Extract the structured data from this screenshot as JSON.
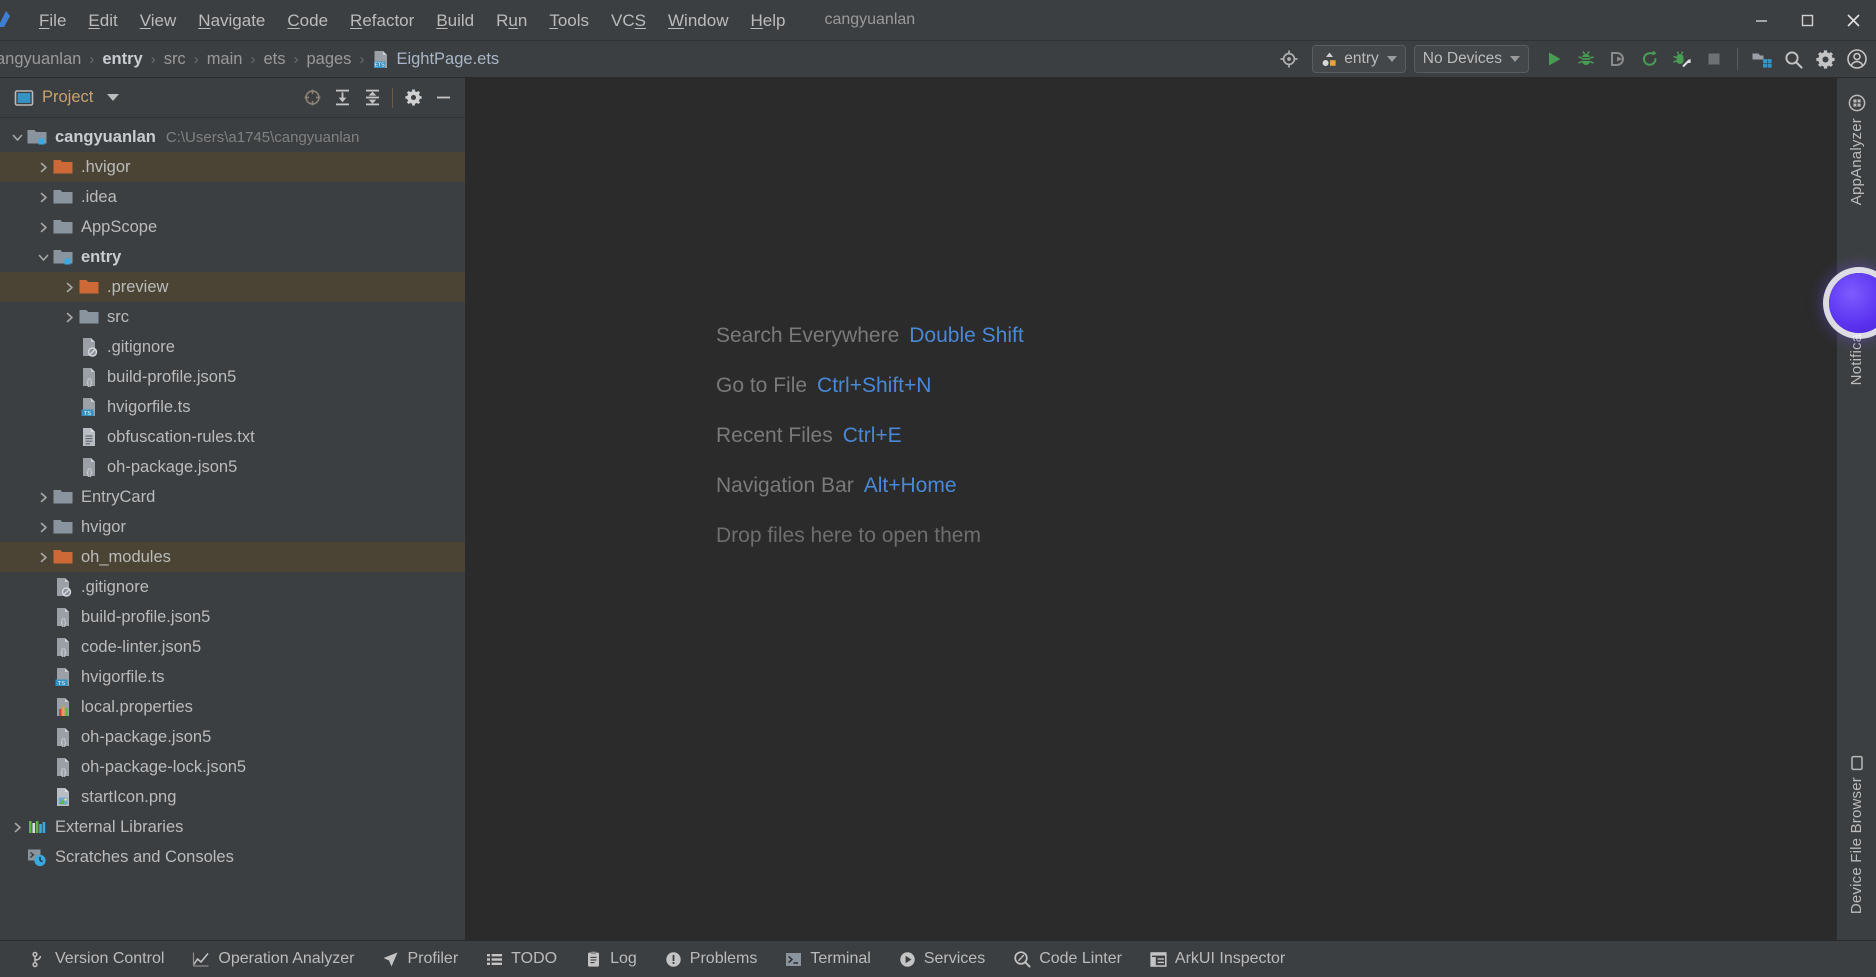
{
  "window": {
    "title": "cangyuanlan",
    "controls": [
      {
        "name": "minimize",
        "glyph": "─"
      },
      {
        "name": "maximize",
        "glyph": "□"
      },
      {
        "name": "close",
        "glyph": "✕"
      }
    ]
  },
  "menubar": {
    "items": [
      {
        "label": "File",
        "mnemonic": "F"
      },
      {
        "label": "Edit",
        "mnemonic": "E"
      },
      {
        "label": "View",
        "mnemonic": "V"
      },
      {
        "label": "Navigate",
        "mnemonic": "N"
      },
      {
        "label": "Code",
        "mnemonic": "C"
      },
      {
        "label": "Refactor",
        "mnemonic": "R"
      },
      {
        "label": "Build",
        "mnemonic": "B"
      },
      {
        "label": "Run",
        "mnemonic": "u"
      },
      {
        "label": "Tools",
        "mnemonic": "T"
      },
      {
        "label": "VCS",
        "mnemonic": "S"
      },
      {
        "label": "Window",
        "mnemonic": "W"
      },
      {
        "label": "Help",
        "mnemonic": "H"
      }
    ]
  },
  "toolbar": {
    "breadcrumbs": [
      {
        "label": "angyuanlan",
        "style": "dim"
      },
      {
        "label": "entry",
        "style": "bold"
      },
      {
        "label": "src",
        "style": "dim"
      },
      {
        "label": "main",
        "style": "dim"
      },
      {
        "label": "ets",
        "style": "dim"
      },
      {
        "label": "pages",
        "style": "dim"
      },
      {
        "label": "EightPage.ets",
        "style": "file",
        "icon": "ets-file-icon"
      }
    ],
    "separator": "›",
    "target_icon": "select-target-icon",
    "run_config": {
      "label": "entry",
      "icon": "module-icon"
    },
    "device_select": {
      "label": "No Devices"
    },
    "actions": [
      {
        "name": "run-button",
        "icon": "run-icon"
      },
      {
        "name": "debug-button",
        "icon": "debug-icon"
      },
      {
        "name": "profile-button",
        "icon": "profile-icon"
      },
      {
        "name": "rerun-button",
        "icon": "rerun-icon"
      },
      {
        "name": "attach-debugger-button",
        "icon": "attach-debugger-icon"
      },
      {
        "name": "stop-button",
        "icon": "stop-icon"
      },
      {
        "name": "project-structure-button",
        "icon": "project-structure-icon"
      },
      {
        "name": "search-button",
        "icon": "search-icon"
      },
      {
        "name": "settings-button",
        "icon": "gear-icon"
      },
      {
        "name": "account-button",
        "icon": "account-icon"
      }
    ]
  },
  "project_panel": {
    "title": "Project",
    "actions": [
      {
        "name": "select-opened-file-button",
        "icon": "crosshair-icon"
      },
      {
        "name": "expand-all-button",
        "icon": "expand-all-icon"
      },
      {
        "name": "collapse-all-button",
        "icon": "collapse-all-icon"
      },
      {
        "name": "panel-settings-button",
        "icon": "gear-icon"
      },
      {
        "name": "hide-panel-button",
        "icon": "minimize-icon"
      }
    ],
    "tree": [
      {
        "label": "cangyuanlan",
        "sub": "C:\\Users\\a1745\\cangyuanlan",
        "depth": 0,
        "arrow": "down",
        "icon": "module-folder-icon",
        "bold": true,
        "hl": false
      },
      {
        "label": ".hvigor",
        "sub": "",
        "depth": 1,
        "arrow": "right",
        "icon": "excluded-folder-icon",
        "bold": false,
        "hl": true
      },
      {
        "label": ".idea",
        "sub": "",
        "depth": 1,
        "arrow": "right",
        "icon": "folder-icon",
        "bold": false,
        "hl": false
      },
      {
        "label": "AppScope",
        "sub": "",
        "depth": 1,
        "arrow": "right",
        "icon": "folder-icon",
        "bold": false,
        "hl": false
      },
      {
        "label": "entry",
        "sub": "",
        "depth": 1,
        "arrow": "down",
        "icon": "module-folder-icon",
        "bold": true,
        "hl": false
      },
      {
        "label": ".preview",
        "sub": "",
        "depth": 2,
        "arrow": "right",
        "icon": "excluded-folder-icon",
        "bold": false,
        "hl": true
      },
      {
        "label": "src",
        "sub": "",
        "depth": 2,
        "arrow": "right",
        "icon": "folder-icon",
        "bold": false,
        "hl": false
      },
      {
        "label": ".gitignore",
        "sub": "",
        "depth": 2,
        "arrow": "none",
        "icon": "gitignore-file-icon",
        "bold": false,
        "hl": false
      },
      {
        "label": "build-profile.json5",
        "sub": "",
        "depth": 2,
        "arrow": "none",
        "icon": "json5-file-icon",
        "bold": false,
        "hl": false
      },
      {
        "label": "hvigorfile.ts",
        "sub": "",
        "depth": 2,
        "arrow": "none",
        "icon": "ts-file-icon",
        "bold": false,
        "hl": false
      },
      {
        "label": "obfuscation-rules.txt",
        "sub": "",
        "depth": 2,
        "arrow": "none",
        "icon": "text-file-icon",
        "bold": false,
        "hl": false
      },
      {
        "label": "oh-package.json5",
        "sub": "",
        "depth": 2,
        "arrow": "none",
        "icon": "json5-file-icon",
        "bold": false,
        "hl": false
      },
      {
        "label": "EntryCard",
        "sub": "",
        "depth": 1,
        "arrow": "right",
        "icon": "folder-icon",
        "bold": false,
        "hl": false
      },
      {
        "label": "hvigor",
        "sub": "",
        "depth": 1,
        "arrow": "right",
        "icon": "folder-icon",
        "bold": false,
        "hl": false
      },
      {
        "label": "oh_modules",
        "sub": "",
        "depth": 1,
        "arrow": "right",
        "icon": "excluded-folder-icon",
        "bold": false,
        "hl": true
      },
      {
        "label": ".gitignore",
        "sub": "",
        "depth": 1,
        "arrow": "none",
        "icon": "gitignore-file-icon",
        "bold": false,
        "hl": false
      },
      {
        "label": "build-profile.json5",
        "sub": "",
        "depth": 1,
        "arrow": "none",
        "icon": "json5-file-icon",
        "bold": false,
        "hl": false
      },
      {
        "label": "code-linter.json5",
        "sub": "",
        "depth": 1,
        "arrow": "none",
        "icon": "json5-file-icon",
        "bold": false,
        "hl": false
      },
      {
        "label": "hvigorfile.ts",
        "sub": "",
        "depth": 1,
        "arrow": "none",
        "icon": "ts-file-icon",
        "bold": false,
        "hl": false
      },
      {
        "label": "local.properties",
        "sub": "",
        "depth": 1,
        "arrow": "none",
        "icon": "properties-file-icon",
        "bold": false,
        "hl": false
      },
      {
        "label": "oh-package.json5",
        "sub": "",
        "depth": 1,
        "arrow": "none",
        "icon": "json5-file-icon",
        "bold": false,
        "hl": false
      },
      {
        "label": "oh-package-lock.json5",
        "sub": "",
        "depth": 1,
        "arrow": "none",
        "icon": "json5-file-icon",
        "bold": false,
        "hl": false
      },
      {
        "label": "startIcon.png",
        "sub": "",
        "depth": 1,
        "arrow": "none",
        "icon": "image-file-icon",
        "bold": false,
        "hl": false
      },
      {
        "label": "External Libraries",
        "sub": "",
        "depth": 0,
        "arrow": "right",
        "icon": "libraries-icon",
        "bold": false,
        "hl": false
      },
      {
        "label": "Scratches and Consoles",
        "sub": "",
        "depth": 0,
        "arrow": "none",
        "icon": "scratches-icon",
        "bold": false,
        "hl": false
      }
    ]
  },
  "editor": {
    "hints": [
      {
        "label": "Search Everywhere",
        "key": "Double Shift"
      },
      {
        "label": "Go to File",
        "key": "Ctrl+Shift+N"
      },
      {
        "label": "Recent Files",
        "key": "Ctrl+E"
      },
      {
        "label": "Navigation Bar",
        "key": "Alt+Home"
      },
      {
        "label": "Drop files here to open them",
        "key": ""
      }
    ]
  },
  "right_sidebar": {
    "top": [
      {
        "label": "AppAnalyzer",
        "icon": "app-analyzer-icon"
      },
      {
        "label": "Notifications",
        "icon": "notifications-icon"
      }
    ],
    "bottom": [
      {
        "label": "Device File Browser",
        "icon": "device-icon"
      }
    ]
  },
  "statusbar": {
    "items": [
      {
        "label": "Version Control",
        "icon": "branch-icon"
      },
      {
        "label": "Operation Analyzer",
        "icon": "chart-icon"
      },
      {
        "label": "Profiler",
        "icon": "profiler-icon"
      },
      {
        "label": "TODO",
        "icon": "list-icon"
      },
      {
        "label": "Log",
        "icon": "clipboard-icon"
      },
      {
        "label": "Problems",
        "icon": "warning-icon"
      },
      {
        "label": "Terminal",
        "icon": "terminal-icon"
      },
      {
        "label": "Services",
        "icon": "services-icon"
      },
      {
        "label": "Code Linter",
        "icon": "linter-icon"
      },
      {
        "label": "ArkUI Inspector",
        "icon": "inspector-icon"
      }
    ]
  },
  "colors": {
    "background": "#3c3f41",
    "editor_background": "#2b2b2b",
    "accent_blue": "#4a88d6",
    "highlight_row": "#4b4434",
    "excluded_orange": "#cc6936",
    "panel_title": "#c9a26d",
    "green_run": "#499c54"
  }
}
